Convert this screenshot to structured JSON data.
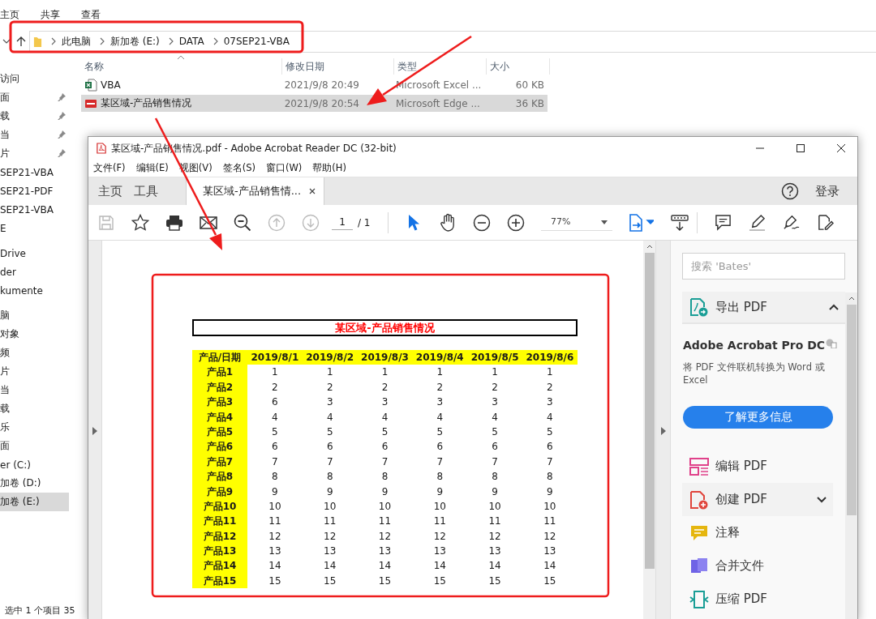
{
  "explorer": {
    "ribbon_tabs": [
      "主页",
      "共享",
      "查看"
    ],
    "breadcrumb": [
      "此电脑",
      "新加卷 (E:)",
      "DATA",
      "07SEP21-VBA"
    ],
    "columns": [
      "名称",
      "修改日期",
      "类型",
      "大小"
    ],
    "files": [
      {
        "kind": "excel",
        "name": "VBA",
        "modified": "2021/9/8 20:49",
        "type": "Microsoft Excel ...",
        "size": "60 KB",
        "selected": false
      },
      {
        "kind": "pdf",
        "name": "某区域-产品销售情况",
        "modified": "2021/9/8 20:54",
        "type": "Microsoft Edge ...",
        "size": "36 KB",
        "selected": true
      }
    ],
    "sidebar_groups": [
      {
        "items": [
          {
            "label": "访问",
            "pinned": false,
            "selected": false
          },
          {
            "label": "面",
            "pinned": true,
            "selected": false
          },
          {
            "label": "载",
            "pinned": true,
            "selected": false
          },
          {
            "label": "当",
            "pinned": true,
            "selected": false
          },
          {
            "label": "片",
            "pinned": true,
            "selected": false
          },
          {
            "label": "SEP21-VBA",
            "pinned": false,
            "selected": false
          },
          {
            "label": "SEP21-PDF",
            "pinned": false,
            "selected": false
          },
          {
            "label": "SEP21-VBA",
            "pinned": false,
            "selected": false
          },
          {
            "label": "E",
            "pinned": false,
            "selected": false
          }
        ]
      },
      {
        "items": [
          {
            "label": "Drive",
            "pinned": false,
            "selected": false
          },
          {
            "label": "der",
            "pinned": false,
            "selected": false
          },
          {
            "label": "kumente",
            "pinned": false,
            "selected": false
          }
        ]
      },
      {
        "items": [
          {
            "label": "脑",
            "pinned": false,
            "selected": false
          },
          {
            "label": "对象",
            "pinned": false,
            "selected": false
          },
          {
            "label": "频",
            "pinned": false,
            "selected": false
          },
          {
            "label": "片",
            "pinned": false,
            "selected": false
          },
          {
            "label": "当",
            "pinned": false,
            "selected": false
          },
          {
            "label": "载",
            "pinned": false,
            "selected": false
          },
          {
            "label": "乐",
            "pinned": false,
            "selected": false
          },
          {
            "label": "面",
            "pinned": false,
            "selected": false
          },
          {
            "label": "er (C:)",
            "pinned": false,
            "selected": false
          },
          {
            "label": "加卷 (D:)",
            "pinned": false,
            "selected": false
          },
          {
            "label": "加卷 (E:)",
            "pinned": false,
            "selected": true
          }
        ]
      }
    ],
    "status_bar": "选中 1 个项目 35"
  },
  "acrobat": {
    "title": "某区域-产品销售情况.pdf - Adobe Acrobat Reader DC (32-bit)",
    "menu": [
      "文件(F)",
      "编辑(E)",
      "视图(V)",
      "签名(S)",
      "窗口(W)",
      "帮助(H)"
    ],
    "tabs": [
      {
        "label": "主页",
        "selected": false
      },
      {
        "label": "工具",
        "selected": false
      },
      {
        "label": "某区域-产品销售情...",
        "selected": true
      }
    ],
    "sign_in": "登录",
    "page": "1",
    "page_total": "/ 1",
    "zoom": "77%",
    "document": {
      "title": "某区域-产品销售情况",
      "columns": [
        "产品/日期",
        "2019/8/1",
        "2019/8/2",
        "2019/8/3",
        "2019/8/4",
        "2019/8/5",
        "2019/8/6"
      ],
      "rows": [
        {
          "label": "产品1",
          "values": [
            "1",
            "1",
            "1",
            "1",
            "1",
            "1"
          ]
        },
        {
          "label": "产品2",
          "values": [
            "2",
            "2",
            "2",
            "2",
            "2",
            "2"
          ]
        },
        {
          "label": "产品3",
          "values": [
            "6",
            "3",
            "3",
            "3",
            "3",
            "3"
          ]
        },
        {
          "label": "产品4",
          "values": [
            "4",
            "4",
            "4",
            "4",
            "4",
            "4"
          ]
        },
        {
          "label": "产品5",
          "values": [
            "5",
            "5",
            "5",
            "5",
            "5",
            "5"
          ]
        },
        {
          "label": "产品6",
          "values": [
            "6",
            "6",
            "6",
            "6",
            "6",
            "6"
          ]
        },
        {
          "label": "产品7",
          "values": [
            "7",
            "7",
            "7",
            "7",
            "7",
            "7"
          ]
        },
        {
          "label": "产品8",
          "values": [
            "8",
            "8",
            "8",
            "8",
            "8",
            "8"
          ]
        },
        {
          "label": "产品9",
          "values": [
            "9",
            "9",
            "9",
            "9",
            "9",
            "9"
          ]
        },
        {
          "label": "产品10",
          "values": [
            "10",
            "10",
            "10",
            "10",
            "10",
            "10"
          ]
        },
        {
          "label": "产品11",
          "values": [
            "11",
            "11",
            "11",
            "11",
            "11",
            "11"
          ]
        },
        {
          "label": "产品12",
          "values": [
            "12",
            "12",
            "12",
            "12",
            "12",
            "12"
          ]
        },
        {
          "label": "产品13",
          "values": [
            "13",
            "13",
            "13",
            "13",
            "13",
            "13"
          ]
        },
        {
          "label": "产品14",
          "values": [
            "14",
            "14",
            "14",
            "14",
            "14",
            "14"
          ]
        },
        {
          "label": "产品15",
          "values": [
            "15",
            "15",
            "15",
            "15",
            "15",
            "15"
          ]
        }
      ]
    },
    "tools_pane": {
      "search_placeholder": "搜索 'Bates'",
      "featured": {
        "label": "导出 PDF",
        "expanded": true
      },
      "promo": {
        "title": "Adobe Acrobat Pro DC",
        "text": "将 PDF 文件联机转换为 Word 或 Excel",
        "button": "了解更多信息"
      },
      "tools": [
        {
          "kind": "edit",
          "label": "编辑 PDF",
          "collapsible": false
        },
        {
          "kind": "create",
          "label": "创建 PDF",
          "collapsible": true
        },
        {
          "kind": "comment",
          "label": "注释",
          "collapsible": false
        },
        {
          "kind": "combine",
          "label": "合并文件",
          "collapsible": false
        },
        {
          "kind": "compress",
          "label": "压缩 PDF",
          "collapsible": false
        }
      ]
    }
  }
}
